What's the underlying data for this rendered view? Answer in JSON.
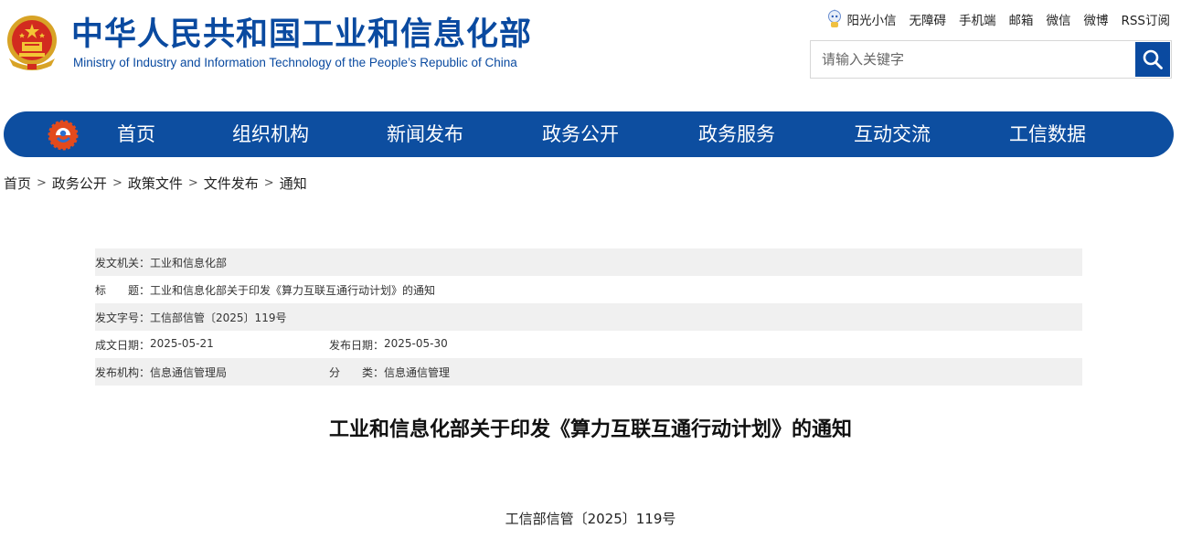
{
  "header": {
    "title": "中华人民共和国工业和信息化部",
    "subtitle": "Ministry of Industry and Information Technology of the People’s Republic of China",
    "top_links": [
      "阳光小信",
      "无障碍",
      "手机端",
      "邮箱",
      "微信",
      "微博",
      "RSS订阅"
    ],
    "search": {
      "placeholder": "请输入关键字"
    }
  },
  "nav": {
    "items": [
      "首页",
      "组织机构",
      "新闻发布",
      "政务公开",
      "政务服务",
      "互动交流",
      "工信数据"
    ]
  },
  "breadcrumb": [
    "首页",
    "政务公开",
    "政策文件",
    "文件发布",
    "通知"
  ],
  "meta": {
    "issuer_label": "发文机关：",
    "issuer": "工业和信息化部",
    "title_label": "标　　题：",
    "title": "工业和信息化部关于印发《算力互联互通行动计划》的通知",
    "doc_no_label": "发文字号：",
    "doc_no": "工信部信管〔2025〕119号",
    "written_label": "成文日期：",
    "written": "2025-05-21",
    "published_label": "发布日期：",
    "published": "2025-05-30",
    "agency_label": "发布机构：",
    "agency": "信息通信管理局",
    "category_label": "分　　类：",
    "category": "信息通信管理"
  },
  "document": {
    "title": "工业和信息化部关于印发《算力互联互通行动计划》的通知",
    "number": "工信部信管〔2025〕119号"
  },
  "colors": {
    "brand_blue": "#0d4ea0",
    "title_blue": "#0a4aa0",
    "row_shade": "#f0f0f0"
  }
}
